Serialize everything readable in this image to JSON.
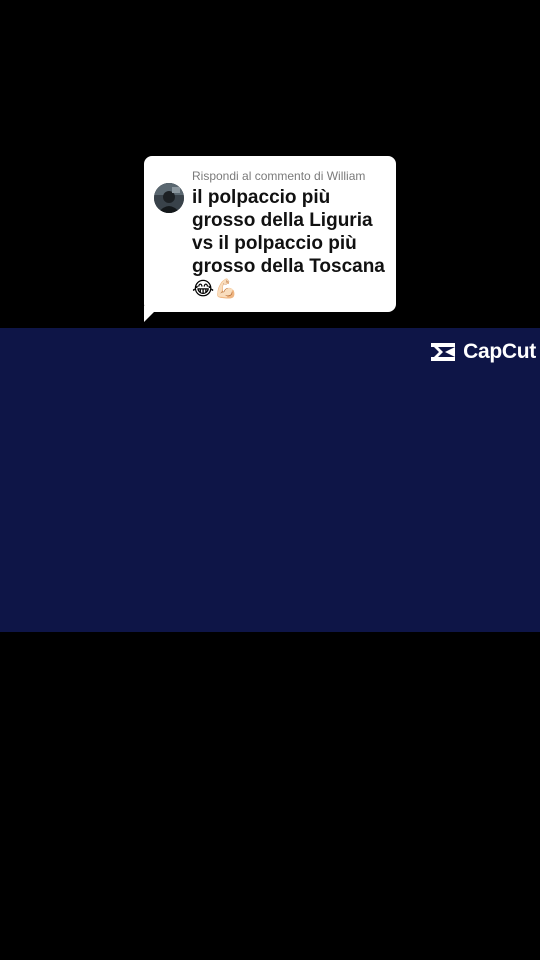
{
  "reply_bubble": {
    "header": "Rispondi al commento di William",
    "comment": "il polpaccio più grosso della Liguria vs il polpaccio più grosso della Toscana",
    "emojis": "😂💪🏻"
  },
  "video": {
    "background_color": "#0e1547",
    "watermark_text": "CapCut"
  },
  "icons": {
    "avatar": "user-avatar",
    "watermark_logo": "capcut-logo-icon"
  }
}
